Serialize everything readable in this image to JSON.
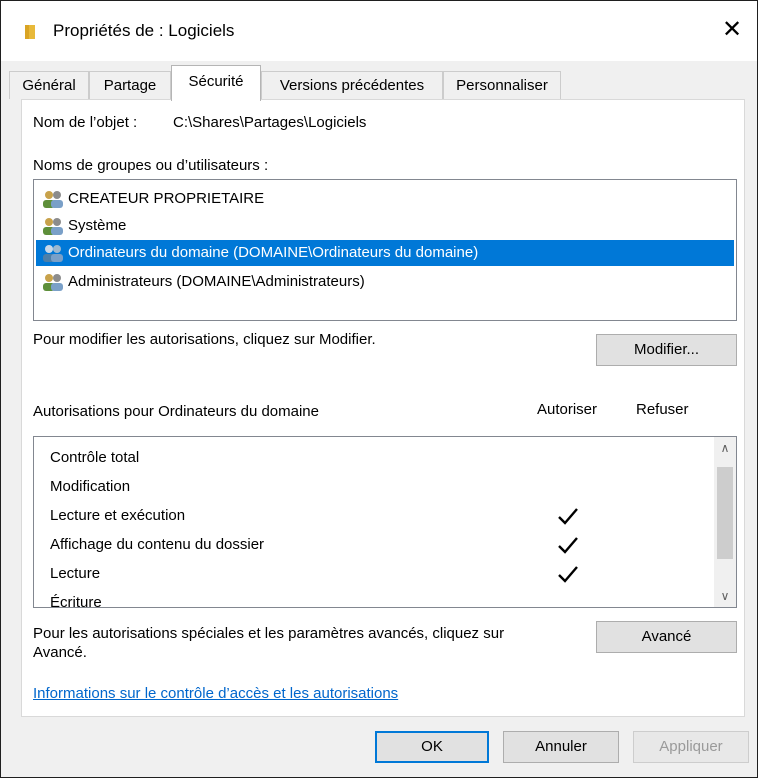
{
  "window": {
    "title": "Propriétés de : Logiciels",
    "close_symbol": "✕",
    "folder_icon": "folder-icon",
    "accent_color": "#0078d7"
  },
  "tabs": [
    {
      "label": "Général"
    },
    {
      "label": "Partage"
    },
    {
      "label": "Sécurité",
      "active": true
    },
    {
      "label": "Versions précédentes"
    },
    {
      "label": "Personnaliser"
    }
  ],
  "object": {
    "label": "Nom de l’objet :",
    "value": "C:\\Shares\\Partages\\Logiciels"
  },
  "groups": {
    "label": "Noms de groupes ou d’utilisateurs :",
    "items": [
      {
        "name": "CREATEUR PROPRIETAIRE"
      },
      {
        "name": "Système"
      },
      {
        "name": "Ordinateurs du domaine (DOMAINE\\Ordinateurs du domaine)",
        "selected": true
      },
      {
        "name": "Administrateurs (DOMAINE\\Administrateurs)"
      }
    ]
  },
  "modify": {
    "hint": "Pour modifier les autorisations, cliquez sur Modifier.",
    "button": "Modifier..."
  },
  "permissions": {
    "label": "Autorisations pour Ordinateurs du domaine",
    "allow_header": "Autoriser",
    "deny_header": "Refuser",
    "rows": [
      {
        "name": "Contrôle total",
        "allow": false,
        "deny": false
      },
      {
        "name": "Modification",
        "allow": false,
        "deny": false
      },
      {
        "name": "Lecture et exécution",
        "allow": true,
        "deny": false
      },
      {
        "name": "Affichage du contenu du dossier",
        "allow": true,
        "deny": false
      },
      {
        "name": "Lecture",
        "allow": true,
        "deny": false
      },
      {
        "name": "Écriture",
        "allow": false,
        "deny": false
      }
    ]
  },
  "advanced": {
    "hint_line1": "Pour les autorisations spéciales et les paramètres avancés, cliquez sur",
    "hint_line2": "Avancé.",
    "button": "Avancé"
  },
  "info_link": "Informations sur le contrôle d’accès et les autorisations",
  "footer": {
    "ok": "OK",
    "cancel": "Annuler",
    "apply": "Appliquer"
  }
}
